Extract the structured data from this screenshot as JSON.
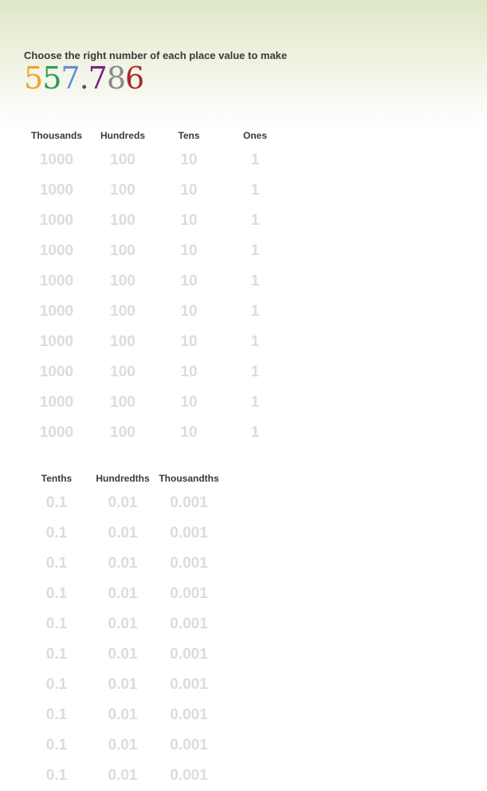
{
  "instruction": "Choose the right number of each place value to make",
  "target_number": {
    "digits": [
      {
        "char": "5",
        "color": "#f2a32a"
      },
      {
        "char": "5",
        "color": "#2f9a5a"
      },
      {
        "char": "7",
        "color": "#5f8fd8"
      },
      {
        "char": ".",
        "color": "#555555"
      },
      {
        "char": "7",
        "color": "#7a1f86"
      },
      {
        "char": "8",
        "color": "#8a8a8a"
      },
      {
        "char": "6",
        "color": "#a82a2a"
      }
    ]
  },
  "whole_columns": [
    {
      "header": "Thousands",
      "tiles": [
        "1000",
        "1000",
        "1000",
        "1000",
        "1000",
        "1000",
        "1000",
        "1000",
        "1000",
        "1000"
      ]
    },
    {
      "header": "Hundreds",
      "tiles": [
        "100",
        "100",
        "100",
        "100",
        "100",
        "100",
        "100",
        "100",
        "100",
        "100"
      ]
    },
    {
      "header": "Tens",
      "tiles": [
        "10",
        "10",
        "10",
        "10",
        "10",
        "10",
        "10",
        "10",
        "10",
        "10"
      ]
    },
    {
      "header": "Ones",
      "tiles": [
        "1",
        "1",
        "1",
        "1",
        "1",
        "1",
        "1",
        "1",
        "1",
        "1"
      ]
    }
  ],
  "decimal_columns": [
    {
      "header": "Tenths",
      "tiles": [
        "0.1",
        "0.1",
        "0.1",
        "0.1",
        "0.1",
        "0.1",
        "0.1",
        "0.1",
        "0.1",
        "0.1"
      ]
    },
    {
      "header": "Hundredths",
      "tiles": [
        "0.01",
        "0.01",
        "0.01",
        "0.01",
        "0.01",
        "0.01",
        "0.01",
        "0.01",
        "0.01",
        "0.01"
      ]
    },
    {
      "header": "Thousandths",
      "tiles": [
        "0.001",
        "0.001",
        "0.001",
        "0.001",
        "0.001",
        "0.001",
        "0.001",
        "0.001",
        "0.001",
        "0.001"
      ]
    }
  ]
}
